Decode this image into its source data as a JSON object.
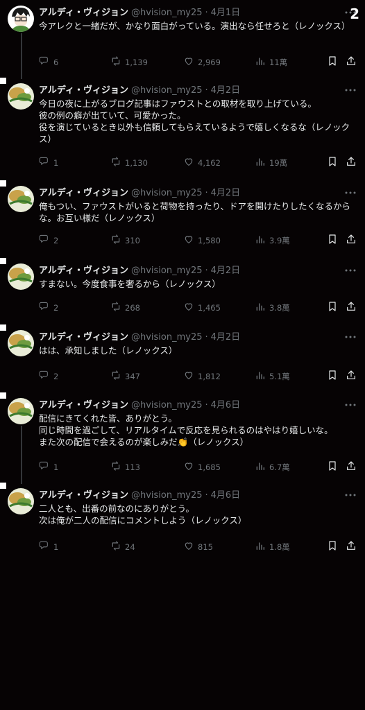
{
  "page_number": "2",
  "author": {
    "display_name": "アルディ・ヴィジョン",
    "handle": "@hvision_my25"
  },
  "tweets": [
    {
      "date": "4月1日",
      "text": "今アレクと一緒だが、かなり面白がっている。演出なら任せろと（レノックス）",
      "counts": {
        "replies": "6",
        "retweets": "1,139",
        "likes": "2,969",
        "views": "11萬"
      }
    },
    {
      "date": "4月2日",
      "text": "今日の夜に上がるブログ記事はファウストとの取材を取り上げている。\n彼の例の癖が出ていて、可愛かった。\n役を演じているとき以外も信頼してもらえているようで嬉しくなるな（レノックス）",
      "counts": {
        "replies": "1",
        "retweets": "1,130",
        "likes": "4,162",
        "views": "19萬"
      }
    },
    {
      "date": "4月2日",
      "text": "俺もつい、ファウストがいると荷物を持ったり、ドアを開けたりしたくなるからな。お互い様だ（レノックス）",
      "counts": {
        "replies": "2",
        "retweets": "310",
        "likes": "1,580",
        "views": "3.9萬"
      }
    },
    {
      "date": "4月2日",
      "text": "すまない。今度食事を奢るから（レノックス）",
      "counts": {
        "replies": "2",
        "retweets": "268",
        "likes": "1,465",
        "views": "3.8萬"
      }
    },
    {
      "date": "4月2日",
      "text": "はは、承知しました（レノックス）",
      "counts": {
        "replies": "2",
        "retweets": "347",
        "likes": "1,812",
        "views": "5.1萬"
      }
    },
    {
      "date": "4月6日",
      "text": "配信にきてくれた皆、ありがとう。\n同じ時間を過ごして、リアルタイムで反応を見られるのはやはり嬉しいな。\nまた次の配信で会えるのが楽しみだ👏（レノックス）",
      "counts": {
        "replies": "1",
        "retweets": "113",
        "likes": "1,685",
        "views": "6.7萬"
      }
    },
    {
      "date": "4月6日",
      "text": "二人とも、出番の前なのにありがとう。\n次は俺が二人の配信にコメントしよう（レノックス）",
      "counts": {
        "replies": "1",
        "retweets": "24",
        "likes": "815",
        "views": "1.8萬"
      }
    }
  ],
  "colors": {
    "background": "#060304",
    "text": "#e7e9ea",
    "muted": "#71767b",
    "thread": "#333639"
  },
  "icons": [
    "reply-icon",
    "retweet-icon",
    "like-icon",
    "views-icon",
    "bookmark-icon",
    "share-icon",
    "more-icon"
  ]
}
